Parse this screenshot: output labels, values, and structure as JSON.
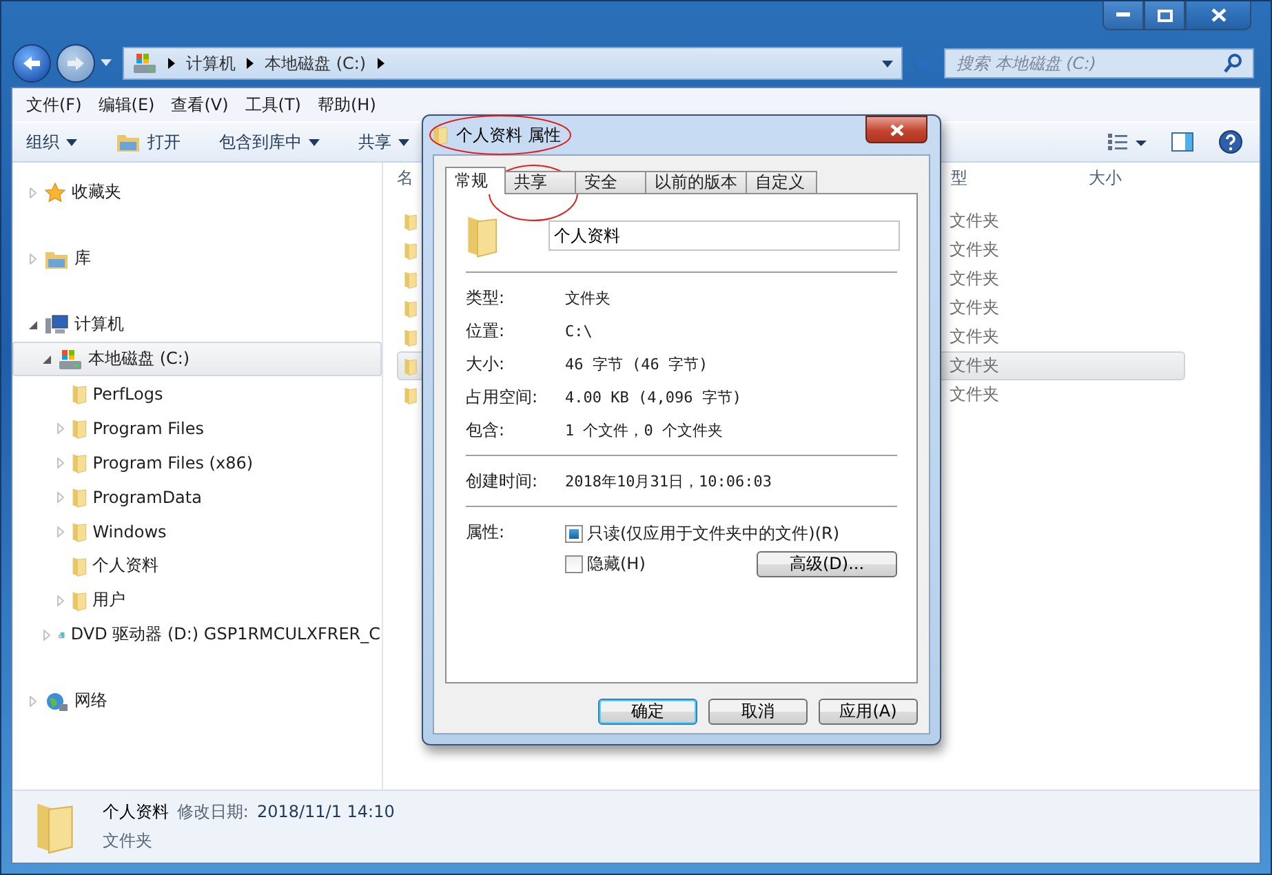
{
  "address_bar": {
    "crumbs": [
      "计算机",
      "本地磁盘 (C:)"
    ]
  },
  "search": {
    "placeholder": "搜索 本地磁盘 (C:)"
  },
  "menu": [
    "文件(F)",
    "编辑(E)",
    "查看(V)",
    "工具(T)",
    "帮助(H)"
  ],
  "toolbar": [
    {
      "label": "组织",
      "kind": "dropdown"
    },
    {
      "label": "打开",
      "kind": "open"
    },
    {
      "label": "包含到库中",
      "kind": "dropdown"
    },
    {
      "label": "共享",
      "kind": "dropdown"
    }
  ],
  "sidebar": {
    "items": [
      {
        "label": "收藏夹",
        "kind": "star",
        "expanded": false,
        "selected": false
      },
      {
        "label": "库",
        "kind": "library",
        "expanded": false,
        "selected": false
      },
      {
        "label": "计算机",
        "kind": "computer",
        "expanded": true,
        "selected": false,
        "children": [
          {
            "label": "本地磁盘 (C:)",
            "kind": "drive",
            "expanded": true,
            "selected": true,
            "children": [
              {
                "label": "PerfLogs",
                "kind": "folder",
                "selected": false
              },
              {
                "label": "Program Files",
                "kind": "folder",
                "expanded": false,
                "selected": false
              },
              {
                "label": "Program Files (x86)",
                "kind": "folder",
                "expanded": false,
                "selected": false
              },
              {
                "label": "ProgramData",
                "kind": "folder",
                "expanded": false,
                "selected": false
              },
              {
                "label": "Windows",
                "kind": "folder",
                "expanded": false,
                "selected": false
              },
              {
                "label": "个人资料",
                "kind": "folder",
                "selected": false
              },
              {
                "label": "用户",
                "kind": "folder",
                "expanded": false,
                "selected": false
              }
            ]
          },
          {
            "label": "DVD 驱动器 (D:) GSP1RMCULXFRER_C",
            "kind": "dvd",
            "expanded": false,
            "selected": false
          }
        ]
      },
      {
        "label": "网络",
        "kind": "network",
        "expanded": false,
        "selected": false
      }
    ]
  },
  "file_list": {
    "columns": [
      "名",
      "型",
      "大小"
    ],
    "rows": [
      {
        "type": "文件夹",
        "selected": false
      },
      {
        "type": "文件夹",
        "selected": false
      },
      {
        "type": "文件夹",
        "selected": false
      },
      {
        "type": "文件夹",
        "selected": false
      },
      {
        "type": "文件夹",
        "selected": false
      },
      {
        "type": "文件夹",
        "selected": true
      },
      {
        "type": "文件夹",
        "selected": false
      }
    ]
  },
  "details_pane": {
    "name": "个人资料",
    "meta_label": "修改日期:",
    "meta_value": "2018/11/1 14:10",
    "type": "文件夹"
  },
  "dialog": {
    "title": "个人资料 属性",
    "tabs": [
      {
        "label": "常规",
        "selected": true
      },
      {
        "label": "共享",
        "selected": false
      },
      {
        "label": "安全",
        "selected": false
      },
      {
        "label": "以前的版本",
        "selected": false
      },
      {
        "label": "自定义",
        "selected": false
      }
    ],
    "name_value": "个人资料",
    "groups": [
      [
        {
          "label": "类型:",
          "value": "文件夹"
        },
        {
          "label": "位置:",
          "value": "C:\\"
        },
        {
          "label": "大小:",
          "value": "46 字节 (46 字节)"
        },
        {
          "label": "占用空间:",
          "value": "4.00 KB (4,096 字节)"
        },
        {
          "label": "包含:",
          "value": "1 个文件，0 个文件夹"
        }
      ],
      [
        {
          "label": "创建时间:",
          "value": "2018年10月31日，10:06:03"
        }
      ]
    ],
    "attributes_label": "属性:",
    "attributes": [
      {
        "label": "只读(仅应用于文件夹中的文件)(R)",
        "checked": true
      },
      {
        "label": "隐藏(H)",
        "checked": false
      }
    ],
    "advanced_button": "高级(D)...",
    "buttons": [
      {
        "label": "确定",
        "default": true
      },
      {
        "label": "取消",
        "default": false
      },
      {
        "label": "应用(A)",
        "default": false
      }
    ]
  }
}
